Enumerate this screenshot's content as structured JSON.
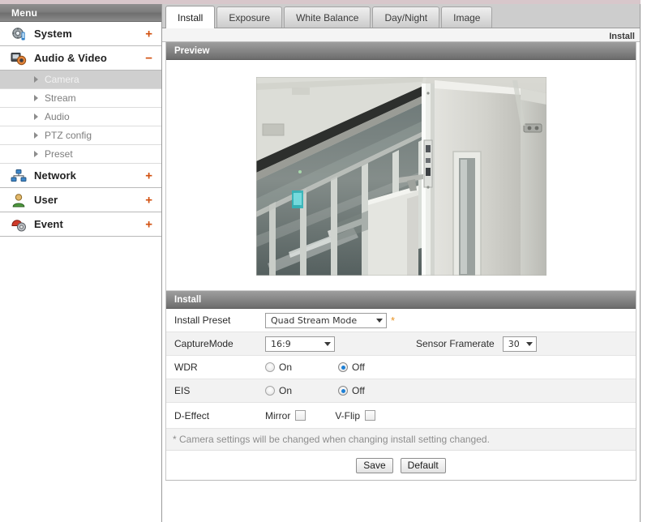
{
  "sidebar": {
    "header": "Menu",
    "top_items": [
      {
        "label": "System",
        "icon": "system-gear-icon",
        "toggle": "+",
        "expanded": false
      },
      {
        "label": "Audio & Video",
        "icon": "audio-video-camera-icon",
        "toggle": "−",
        "expanded": true
      },
      {
        "label": "Network",
        "icon": "network-nodes-icon",
        "toggle": "+",
        "expanded": false
      },
      {
        "label": "User",
        "icon": "user-person-icon",
        "toggle": "+",
        "expanded": false
      },
      {
        "label": "Event",
        "icon": "event-alarm-icon",
        "toggle": "+",
        "expanded": false
      }
    ],
    "sub_items": [
      {
        "label": "Camera",
        "active": true
      },
      {
        "label": "Stream",
        "active": false
      },
      {
        "label": "Audio",
        "active": false
      },
      {
        "label": "PTZ config",
        "active": false
      },
      {
        "label": "Preset",
        "active": false
      }
    ]
  },
  "tabs": [
    {
      "label": "Install",
      "active": true
    },
    {
      "label": "Exposure",
      "active": false
    },
    {
      "label": "White Balance",
      "active": false
    },
    {
      "label": "Day/Night",
      "active": false
    },
    {
      "label": "Image",
      "active": false
    }
  ],
  "breadcrumb": "Install",
  "preview": {
    "section_title": "Preview",
    "image_alt": "live-camera-preview-corridor-glass-wall-white-door"
  },
  "install": {
    "section_title": "Install",
    "rows": {
      "install_preset": {
        "label": "Install Preset",
        "value": "Quad Stream Mode",
        "required_marker": "*"
      },
      "capture_mode": {
        "label": "CaptureMode",
        "value": "16:9"
      },
      "sensor_framerate": {
        "label": "Sensor Framerate",
        "value": "30"
      },
      "wdr": {
        "label": "WDR",
        "on_label": "On",
        "off_label": "Off",
        "selected": "Off"
      },
      "eis": {
        "label": "EIS",
        "on_label": "On",
        "off_label": "Off",
        "selected": "Off"
      },
      "d_effect": {
        "label": "D-Effect",
        "mirror_label": "Mirror",
        "mirror_checked": false,
        "vflip_label": "V-Flip",
        "vflip_checked": false
      }
    },
    "note": "* Camera settings will be changed when changing install setting changed.",
    "buttons": {
      "save": "Save",
      "default": "Default"
    }
  },
  "colors": {
    "accent_orange": "#d2500f",
    "required_star": "#e8901e",
    "radio_selected": "#1d7fd4",
    "sidebar_active_bg": "#cfcfcf",
    "section_bar": "#8b8b8b"
  }
}
